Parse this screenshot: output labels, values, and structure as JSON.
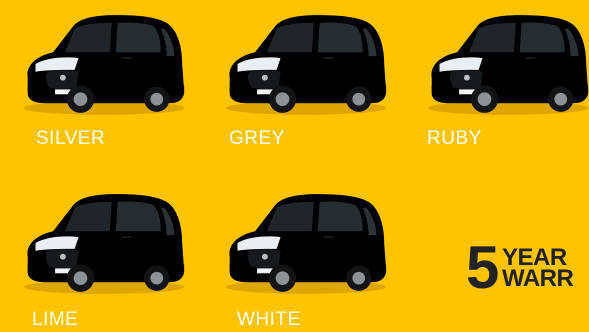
{
  "colors": [
    {
      "label": "SILVER",
      "body": "#c9cbcd",
      "shade": "#8e9194"
    },
    {
      "label": "GREY",
      "body": "#7a6a5c",
      "shade": "#4d4238"
    },
    {
      "label": "RUBY",
      "body": "#d6192a",
      "shade": "#8c0d18"
    },
    {
      "label": "LIME",
      "body": "#8bb425",
      "shade": "#557314"
    },
    {
      "label": "WHITE",
      "body": "#f1f1f1",
      "shade": "#b9bcbf"
    }
  ],
  "warranty": {
    "number": "5",
    "line1": "YEAR",
    "line2": "WARR"
  },
  "background_color": "#ffc400",
  "label_color": "#ffffff"
}
